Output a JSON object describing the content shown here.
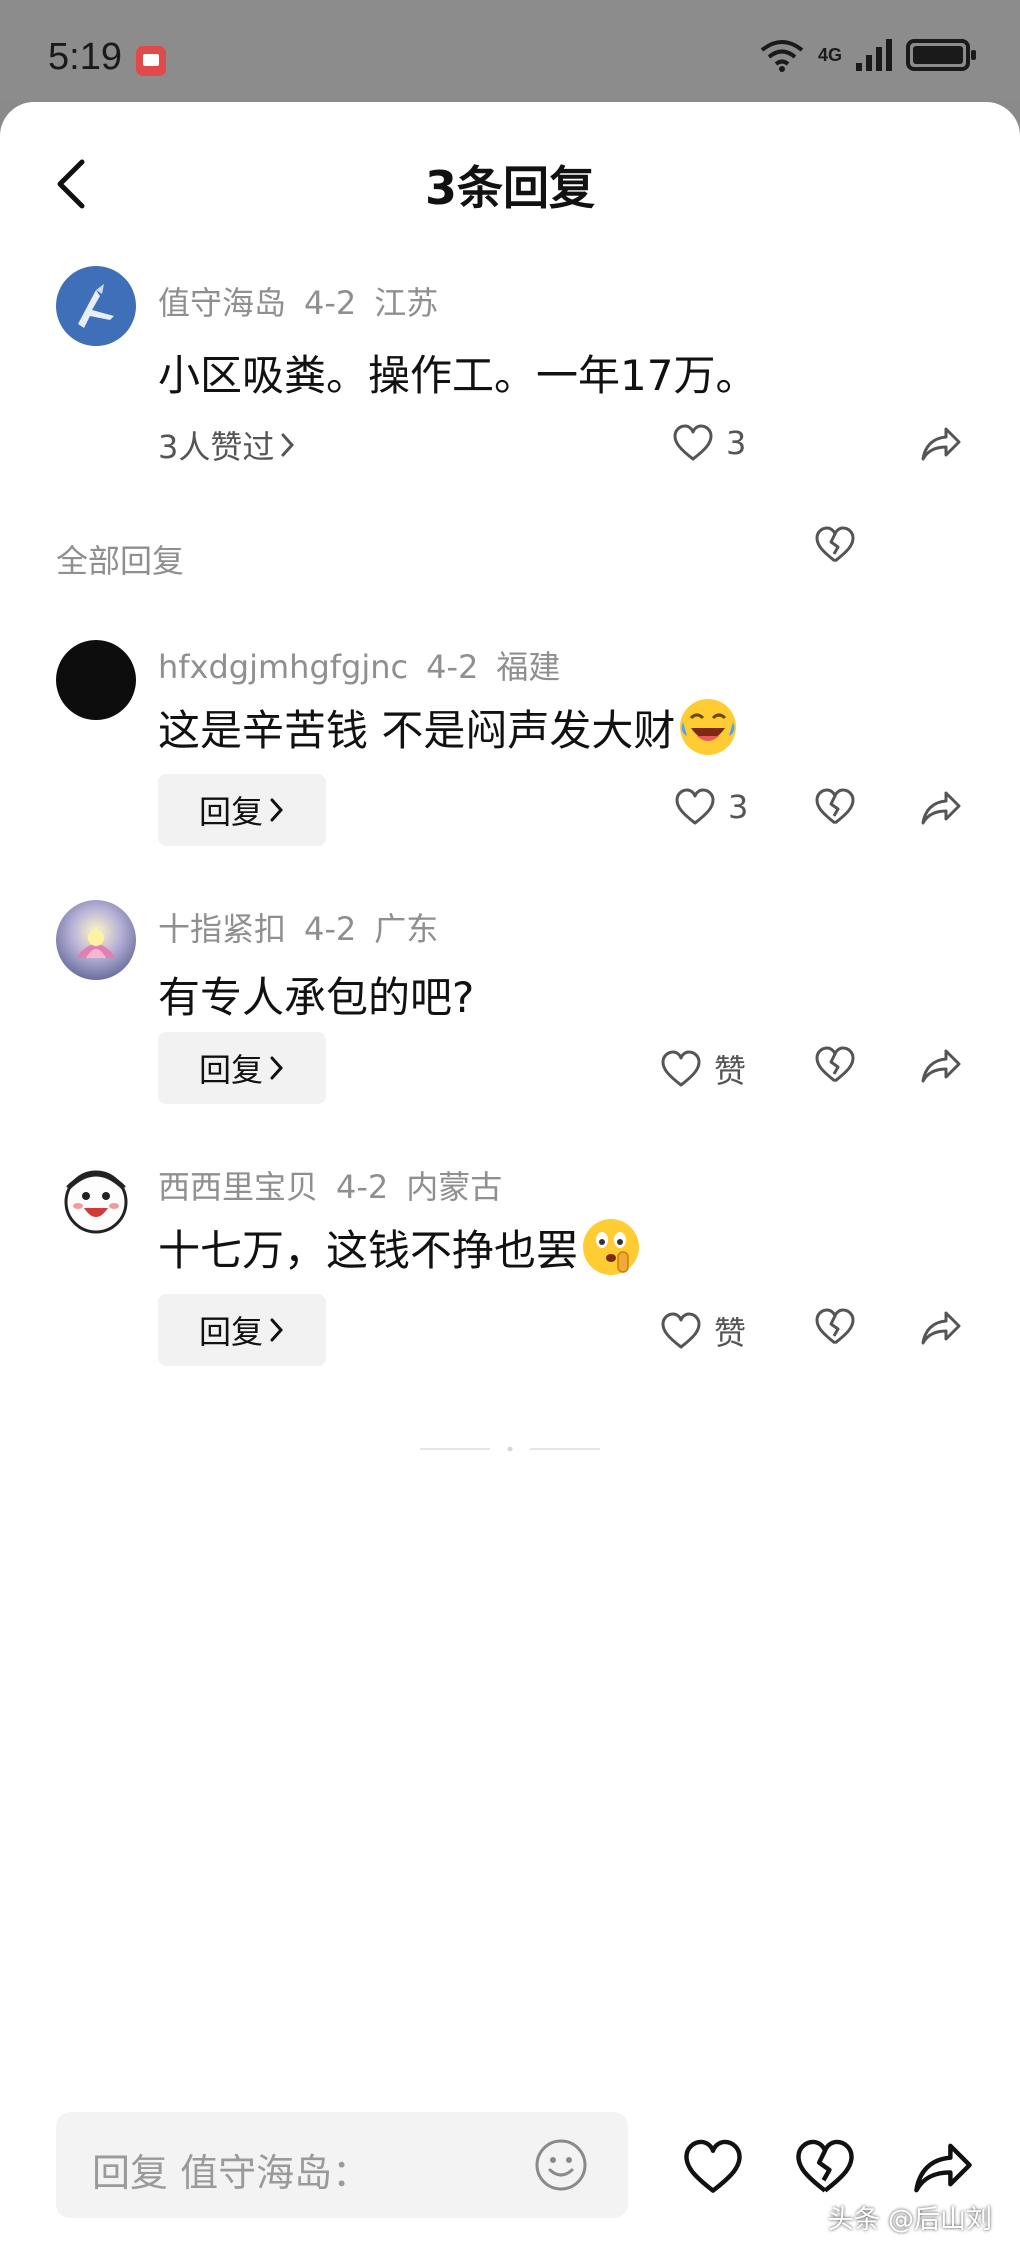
{
  "status_bar": {
    "time": "5:19",
    "network": "4G"
  },
  "header": {
    "title": "3条回复"
  },
  "main_comment": {
    "username": "值守海岛",
    "date": "4-2",
    "location": "江苏",
    "text": "小区吸粪。操作工。一年17万。",
    "likes_link": "3人赞过",
    "like_count": "3"
  },
  "section_label": "全部回复",
  "replies": [
    {
      "username": "hfxdgjmhgfgjnc",
      "date": "4-2",
      "location": "福建",
      "text": "这是辛苦钱 不是闷声发大财",
      "emoji": "laughing-crying-emoji",
      "reply_label": "回复",
      "like_label": "3"
    },
    {
      "username": "十指紧扣",
      "date": "4-2",
      "location": "广东",
      "text": "有专人承包的吧?",
      "reply_label": "回复",
      "like_label": "赞"
    },
    {
      "username": "西西里宝贝",
      "date": "4-2",
      "location": "内蒙古",
      "text": "十七万，这钱不挣也罢",
      "emoji": "shushing-face-emoji",
      "reply_label": "回复",
      "like_label": "赞"
    }
  ],
  "bottom_bar": {
    "placeholder": "回复 值守海岛："
  },
  "watermark": "头条 @后山刘",
  "colors": {
    "background": "#ffffff",
    "meta_text": "#8f8f8f",
    "reply_button_bg": "#f2f2f2",
    "icon": "#555555"
  }
}
